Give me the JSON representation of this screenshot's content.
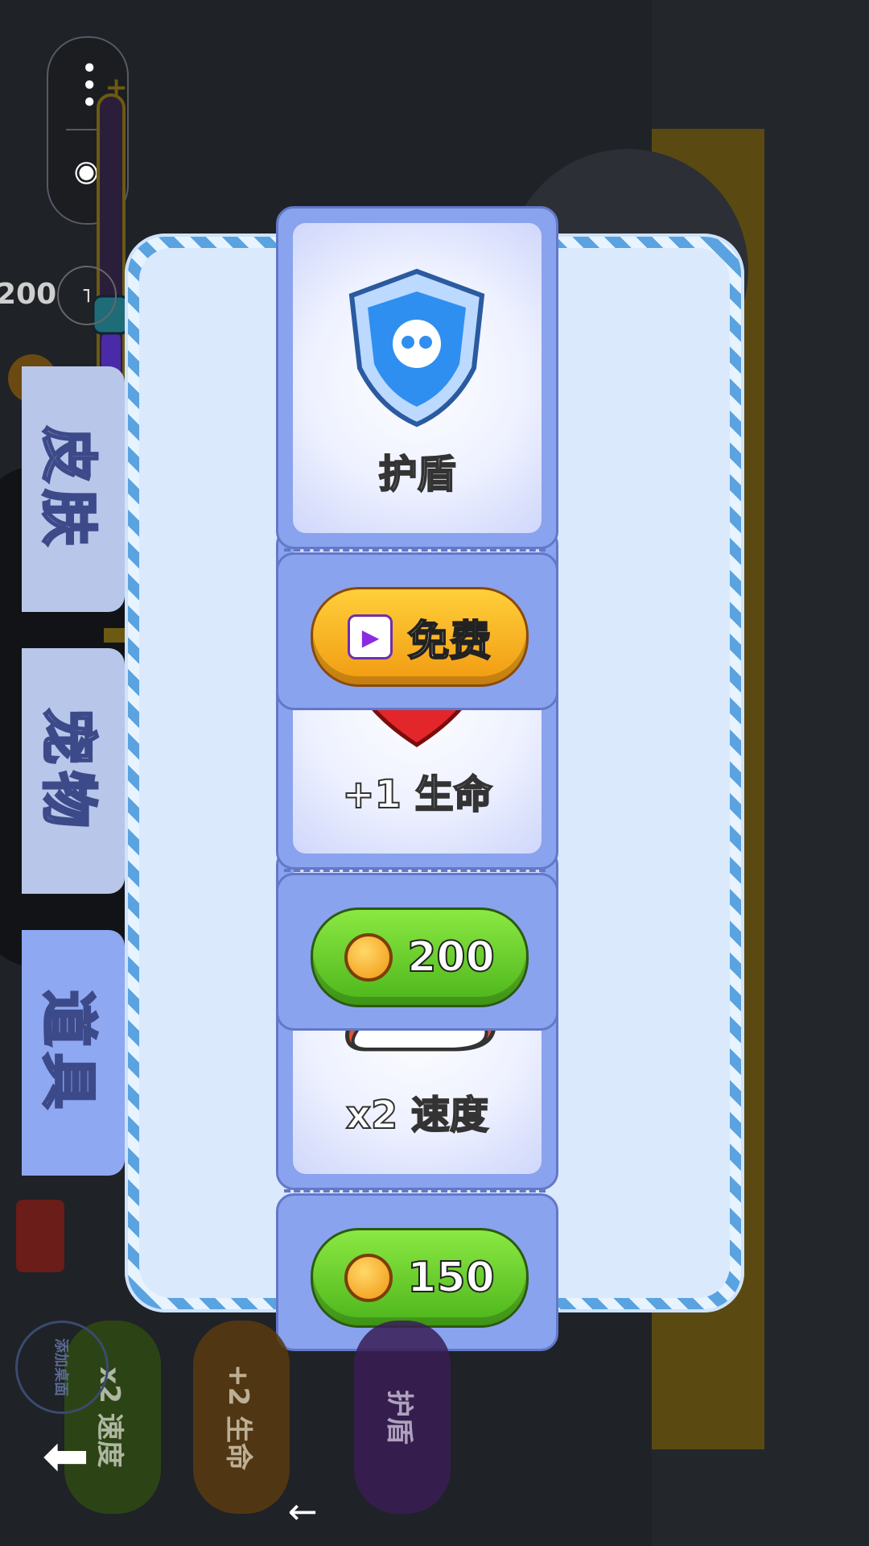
{
  "tabs": [
    {
      "label": "道具",
      "active": true
    },
    {
      "label": "宠物",
      "active": false
    },
    {
      "label": "皮肤",
      "active": false
    }
  ],
  "items": [
    {
      "name": "x2 速度",
      "price": "150",
      "currency": "coin-icon",
      "button_color": "#4cb51b"
    },
    {
      "name": "+1 生命",
      "price": "200",
      "currency": "coin-icon",
      "button_color": "#4cb51b"
    },
    {
      "name": "护盾",
      "price": "免费",
      "currency": "video-play-icon",
      "button_color": "#f19a12"
    }
  ],
  "hud": {
    "score": "200"
  },
  "powerups": [
    {
      "label": "x2 速度"
    },
    {
      "label": "+2 生命"
    },
    {
      "label": "护盾"
    }
  ],
  "side_hint": "添加桌面"
}
